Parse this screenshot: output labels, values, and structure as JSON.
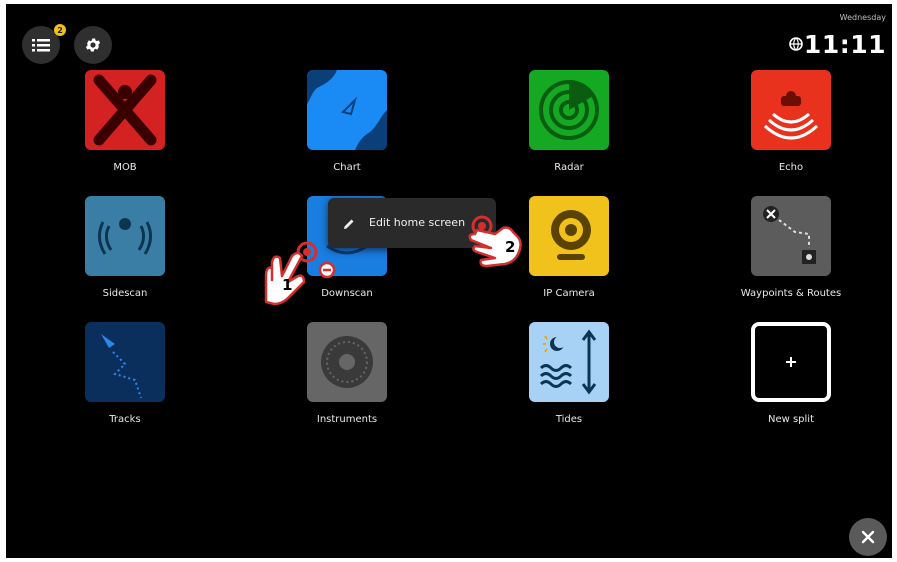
{
  "status": {
    "day": "Wednesday",
    "time": "11:11"
  },
  "menu_badge": "2",
  "tiles": [
    {
      "label": "MOB",
      "color": "#d42222",
      "icon": "mob-icon"
    },
    {
      "label": "Chart",
      "color": "#1a8bf5",
      "icon": "chart-icon"
    },
    {
      "label": "Radar",
      "color": "#14a823",
      "icon": "radar-icon"
    },
    {
      "label": "Echo",
      "color": "#e8321e",
      "icon": "echo-icon"
    },
    {
      "label": "Sidescan",
      "color": "#3a7ea5",
      "icon": "sidescan-icon"
    },
    {
      "label": "Downscan",
      "color": "#1a7de0",
      "icon": "downscan-icon"
    },
    {
      "label": "IP Camera",
      "color": "#f0c21b",
      "icon": "ip-camera-icon"
    },
    {
      "label": "Waypoints & Routes",
      "color": "#5c5c5c",
      "icon": "waypoints-icon"
    },
    {
      "label": "Tracks",
      "color": "#0a2f5c",
      "icon": "tracks-icon"
    },
    {
      "label": "Instruments",
      "color": "#666666",
      "icon": "instruments-icon"
    },
    {
      "label": "Tides",
      "color": "#a8d2f5",
      "icon": "tides-icon"
    },
    {
      "label": "New split",
      "color": "#000000",
      "icon": "plus-icon"
    }
  ],
  "context_menu": {
    "item_label": "Edit home screen",
    "icon": "pencil-icon"
  },
  "callouts": {
    "step1": "1",
    "step2": "2"
  }
}
